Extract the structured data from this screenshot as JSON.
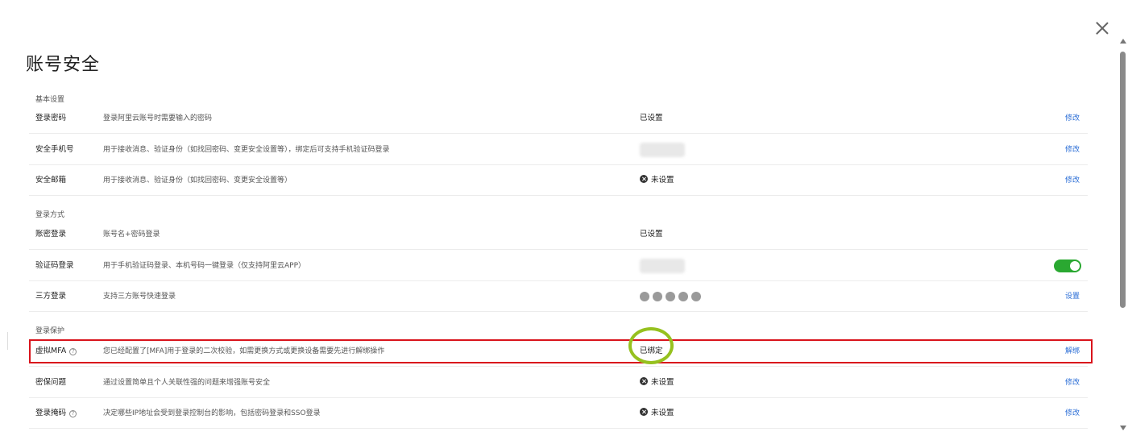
{
  "page": {
    "title": "账号安全",
    "close_label": ""
  },
  "sections": {
    "basic": "基本设置",
    "login_methods": "登录方式",
    "login_protection": "登录保护"
  },
  "rows": {
    "password": {
      "label": "登录密码",
      "desc": "登录阿里云账号时需要输入的密码",
      "status": "已设置",
      "action": "修改"
    },
    "phone": {
      "label": "安全手机号",
      "desc": "用于接收消息、验证身份（如找回密码、变更安全设置等），绑定后可支持手机验证码登录",
      "status": "",
      "action": "修改"
    },
    "email": {
      "label": "安全邮箱",
      "desc": "用于接收消息、验证身份（如找回密码、变更安全设置等）",
      "status": "未设置",
      "action": "修改"
    },
    "account_login": {
      "label": "账密登录",
      "desc": "账号名+密码登录",
      "status": "已设置",
      "action": ""
    },
    "sms_login": {
      "label": "验证码登录",
      "desc": "用于手机验证码登录、本机号码一键登录（仅支持阿里云APP）",
      "status": "",
      "toggle_on": true
    },
    "third_party": {
      "label": "三方登录",
      "desc": "支持三方账号快速登录",
      "status": "",
      "action": "设置",
      "icons": [
        "social-icon-1",
        "social-icon-2",
        "social-icon-3",
        "social-icon-4",
        "social-icon-5"
      ]
    },
    "mfa": {
      "label": "虚拟MFA",
      "desc": "您已经配置了[MFA]用于登录的二次校验，如需更换方式或更换设备需要先进行解绑操作",
      "status": "已绑定",
      "action": "解绑"
    },
    "security_question": {
      "label": "密保问题",
      "desc": "通过设置简单且个人关联性强的问题来增强账号安全",
      "status": "未设置",
      "action": "修改"
    },
    "login_mask": {
      "label": "登录掩码",
      "desc": "决定哪些IP地址会受到登录控制台的影响，包括密码登录和SSO登录",
      "status": "未设置",
      "action": "修改"
    }
  },
  "colors": {
    "link": "#2a6dd6",
    "toggle_on": "#2aa831",
    "highlight_box": "#d9141c",
    "highlight_circle": "#96c11f"
  }
}
